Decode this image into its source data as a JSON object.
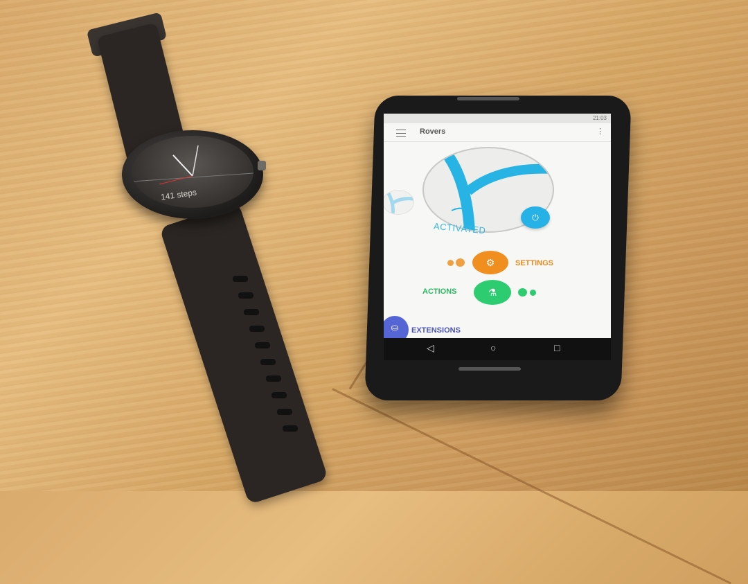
{
  "watch": {
    "steps_text": "141 steps"
  },
  "phone": {
    "statusbar": {
      "time": "21:03"
    },
    "appbar": {
      "title": "Rovers",
      "menu_icon": "hamburger-icon",
      "overflow_icon": "more-vert-icon"
    },
    "status": {
      "label": "ACTIVATED",
      "power_icon": "power-icon"
    },
    "actions": [
      {
        "label": "SETTINGS",
        "icon": "gear-icon",
        "color": "#f08e20"
      },
      {
        "label": "ACTIONS",
        "icon": "flask-icon",
        "color": "#2ecc71"
      },
      {
        "label": "EXTENSIONS",
        "icon": "basket-icon",
        "color": "#5565d6"
      }
    ],
    "navbar": {
      "back_icon": "back-icon",
      "home_icon": "home-icon",
      "recents_icon": "recents-icon"
    },
    "accent_color": "#26b2e6"
  }
}
